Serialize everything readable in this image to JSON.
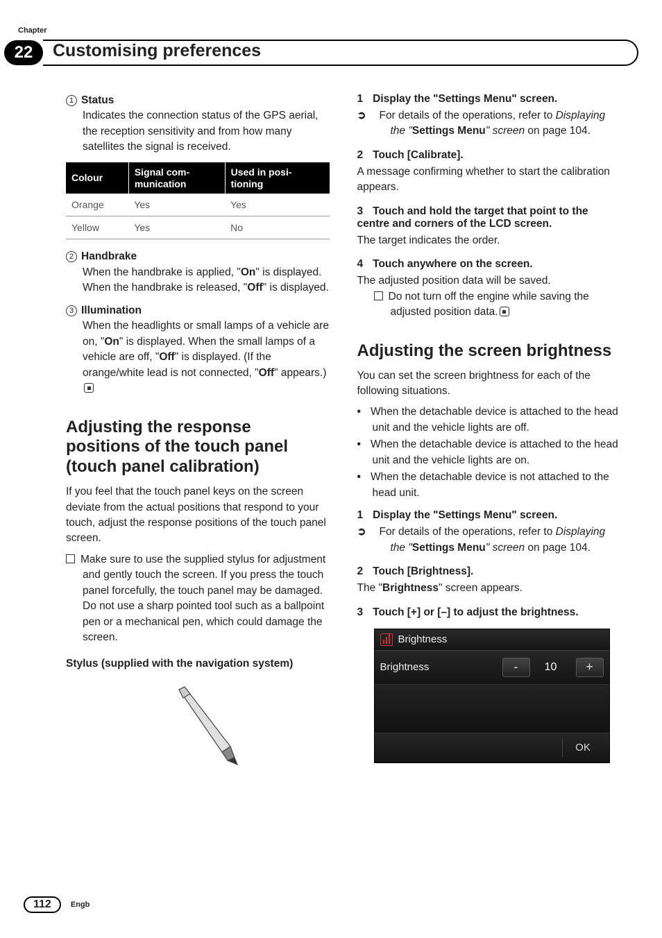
{
  "header": {
    "chapter_label": "Chapter",
    "chapter_number": "22",
    "title": "Customising preferences"
  },
  "left": {
    "status": {
      "num": "1",
      "label": "Status",
      "desc": "Indicates the connection status of the GPS aerial, the reception sensitivity and from how many satellites the signal is received."
    },
    "table": {
      "headers": [
        "Colour",
        "Signal com-\nmunication",
        "Used in posi-\ntioning"
      ],
      "rows": [
        [
          "Orange",
          "Yes",
          "Yes"
        ],
        [
          "Yellow",
          "Yes",
          "No"
        ]
      ]
    },
    "handbrake": {
      "num": "2",
      "label": "Handbrake",
      "pre": "When the handbrake is applied, \"",
      "on": "On",
      "mid": "\" is displayed. When the handbrake is released, \"",
      "off": "Off",
      "post": "\" is displayed."
    },
    "illumination": {
      "num": "3",
      "label": "Illumination",
      "pre": "When the headlights or small lamps of a vehicle are on, \"",
      "on": "On",
      "mid": "\" is displayed. When the small lamps of a vehicle are off, \"",
      "off": "Off",
      "mid2": "\" is displayed. (If the orange/white lead is not connected, \"",
      "off2": "Off",
      "post": "\" appears.)"
    },
    "section_heading": "Adjusting the response positions of the touch panel (touch panel calibration)",
    "intro": "If you feel that the touch panel keys on the screen deviate from the actual positions that respond to your touch, adjust the response positions of the touch panel screen.",
    "note": "Make sure to use the supplied stylus for adjustment and gently touch the screen. If you press the touch panel forcefully, the touch panel may be damaged. Do not use a sharp pointed tool such as a ballpoint pen or a mechanical pen, which could damage the screen.",
    "stylus_heading": "Stylus (supplied with the navigation system)"
  },
  "right": {
    "step1": {
      "num": "1",
      "title": "Display the \"Settings Menu\" screen.",
      "ref_pre": "For details of the operations, refer to ",
      "ref_ital1": "Displaying the \"",
      "ref_bold": "Settings Menu",
      "ref_ital2": "\" screen",
      "ref_post": " on page 104."
    },
    "step2": {
      "num": "2",
      "title": "Touch [Calibrate].",
      "body": "A message confirming whether to start the calibration appears."
    },
    "step3": {
      "num": "3",
      "title": "Touch and hold the target that point to the centre and corners of the LCD screen.",
      "body": "The target indicates the order."
    },
    "step4": {
      "num": "4",
      "title": "Touch anywhere on the screen.",
      "body": "The adjusted position data will be saved.",
      "note": "Do not turn off the engine while saving the adjusted position data."
    },
    "brightness_heading": "Adjusting the screen brightness",
    "brightness_intro": "You can set the screen brightness for each of the following situations.",
    "bullets": [
      "When the detachable device is attached to the head unit and the vehicle lights are off.",
      "When the detachable device is attached to the head unit and the vehicle lights are on.",
      "When the detachable device is not attached to the head unit."
    ],
    "bstep1": {
      "num": "1",
      "title": "Display the \"Settings Menu\" screen.",
      "ref_pre": "For details of the operations, refer to ",
      "ref_ital1": "Displaying the \"",
      "ref_bold": "Settings Menu",
      "ref_ital2": "\" screen",
      "ref_post": " on page 104."
    },
    "bstep2": {
      "num": "2",
      "title": "Touch [Brightness].",
      "body_pre": "The \"",
      "body_bold": "Brightness",
      "body_post": "\" screen appears."
    },
    "bstep3": {
      "num": "3",
      "title": "Touch [+] or [–] to adjust the brightness."
    },
    "panel": {
      "header": "Brightness",
      "row_label": "Brightness",
      "minus": "-",
      "value": "10",
      "plus": "+",
      "ok": "OK"
    }
  },
  "footer": {
    "page_number": "112",
    "lang": "Engb"
  }
}
